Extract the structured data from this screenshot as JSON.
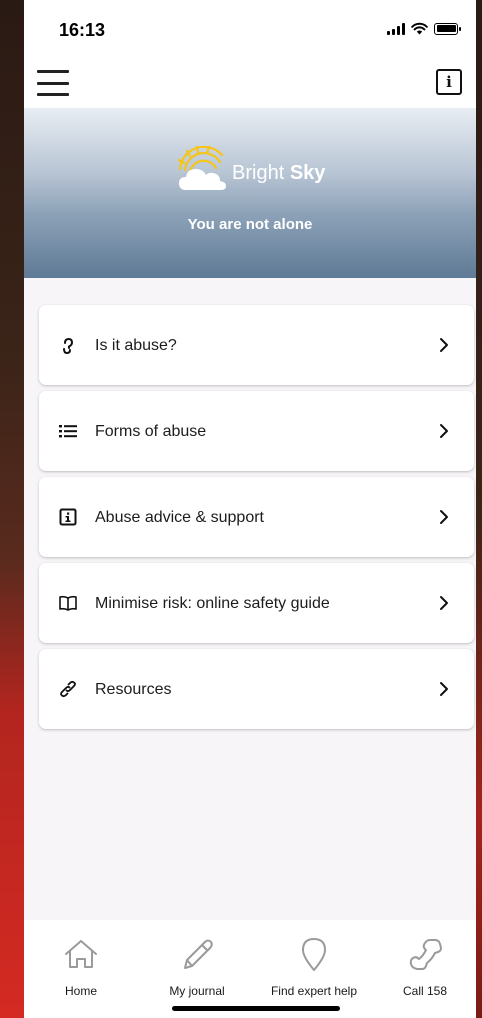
{
  "status_bar": {
    "time": "16:13"
  },
  "header": {
    "menu_icon": "hamburger-icon",
    "info_icon": "info-icon"
  },
  "hero": {
    "logo_word_1": "Bright",
    "logo_word_2": "Sky",
    "tagline": "You are not alone"
  },
  "menu": {
    "items": [
      {
        "label": "Is it abuse?",
        "icon": "question-icon"
      },
      {
        "label": "Forms of abuse",
        "icon": "list-icon"
      },
      {
        "label": "Abuse advice & support",
        "icon": "info-icon"
      },
      {
        "label": "Minimise risk: online safety guide",
        "icon": "book-icon"
      },
      {
        "label": "Resources",
        "icon": "link-icon"
      }
    ]
  },
  "tabs": [
    {
      "label": "Home",
      "icon": "home-icon"
    },
    {
      "label": "My journal",
      "icon": "pencil-icon"
    },
    {
      "label": "Find expert help",
      "icon": "location-pin-icon"
    },
    {
      "label": "Call 158",
      "icon": "phone-icon"
    }
  ],
  "colors": {
    "hero_top": "#e8edf3",
    "hero_bottom": "#5f7a96",
    "logo_sun": "#f5c518",
    "tab_icon_gray": "#9a9a9a"
  }
}
